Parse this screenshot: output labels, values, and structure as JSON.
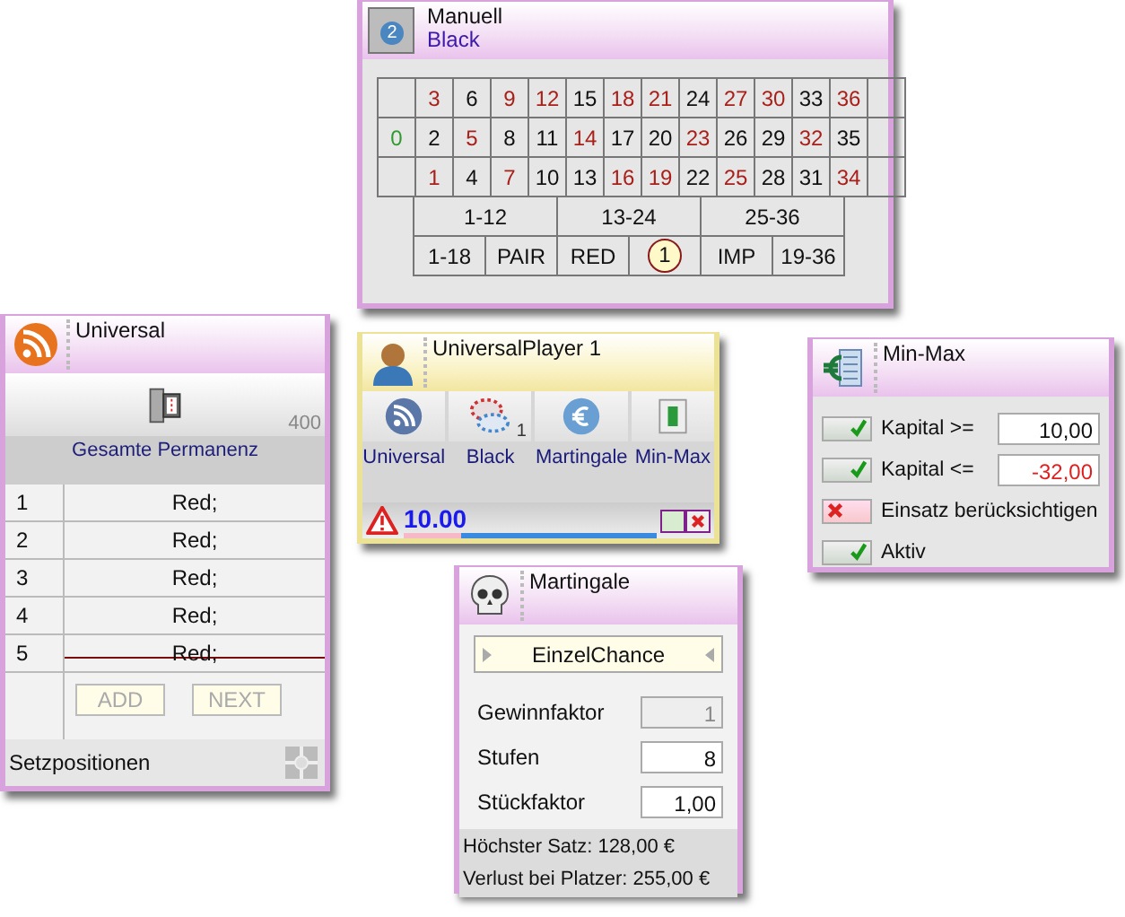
{
  "manuell": {
    "title": "Manuell",
    "subtitle": "Black",
    "badge": "2",
    "grid": [
      {
        "numbers": [
          {
            "label": "3",
            "color": "#a8201a"
          },
          {
            "label": "6",
            "color": "#111111"
          },
          {
            "label": "9",
            "color": "#a8201a"
          },
          {
            "label": "12",
            "color": "#a8201a"
          },
          {
            "label": "15",
            "color": "#111111"
          },
          {
            "label": "18",
            "color": "#a8201a"
          },
          {
            "label": "21",
            "color": "#a8201a"
          },
          {
            "label": "24",
            "color": "#111111"
          },
          {
            "label": "27",
            "color": "#a8201a"
          },
          {
            "label": "30",
            "color": "#a8201a"
          },
          {
            "label": "33",
            "color": "#111111"
          },
          {
            "label": "36",
            "color": "#a8201a"
          }
        ]
      },
      {
        "zero": {
          "label": "0",
          "color": "#2f9a2f"
        },
        "numbers": [
          {
            "label": "2",
            "color": "#111111"
          },
          {
            "label": "5",
            "color": "#a8201a"
          },
          {
            "label": "8",
            "color": "#111111"
          },
          {
            "label": "11",
            "color": "#111111"
          },
          {
            "label": "14",
            "color": "#a8201a"
          },
          {
            "label": "17",
            "color": "#111111"
          },
          {
            "label": "20",
            "color": "#111111"
          },
          {
            "label": "23",
            "color": "#a8201a"
          },
          {
            "label": "26",
            "color": "#111111"
          },
          {
            "label": "29",
            "color": "#111111"
          },
          {
            "label": "32",
            "color": "#a8201a"
          },
          {
            "label": "35",
            "color": "#111111"
          }
        ]
      },
      {
        "numbers": [
          {
            "label": "1",
            "color": "#a8201a"
          },
          {
            "label": "4",
            "color": "#111111"
          },
          {
            "label": "7",
            "color": "#a8201a"
          },
          {
            "label": "10",
            "color": "#111111"
          },
          {
            "label": "13",
            "color": "#111111"
          },
          {
            "label": "16",
            "color": "#a8201a"
          },
          {
            "label": "19",
            "color": "#a8201a"
          },
          {
            "label": "22",
            "color": "#111111"
          },
          {
            "label": "25",
            "color": "#a8201a"
          },
          {
            "label": "28",
            "color": "#111111"
          },
          {
            "label": "31",
            "color": "#111111"
          },
          {
            "label": "34",
            "color": "#a8201a"
          }
        ]
      }
    ],
    "dozens": [
      "1-12",
      "13-24",
      "25-36"
    ],
    "chances": [
      {
        "label": "1-18"
      },
      {
        "label": "PAIR"
      },
      {
        "label": "RED"
      },
      {
        "chip": "1"
      },
      {
        "label": "IMP"
      },
      {
        "label": "19-36"
      }
    ]
  },
  "universal": {
    "title": "Universal",
    "count": "400",
    "caption": "Gesamte Permanenz",
    "rows": [
      {
        "num": "1",
        "value": "Red;",
        "struck": false
      },
      {
        "num": "2",
        "value": "Red;",
        "struck": false
      },
      {
        "num": "3",
        "value": "Red;",
        "struck": false
      },
      {
        "num": "4",
        "value": "Red;",
        "struck": false
      },
      {
        "num": "5",
        "value": "Red;",
        "struck": true
      }
    ],
    "buttons": [
      {
        "label": "ADD",
        "disabled": true
      },
      {
        "label": "NEXT",
        "disabled": true
      }
    ],
    "footer": "Setzpositionen"
  },
  "player": {
    "title": "UniversalPlayer 1",
    "tools": [
      {
        "label": "Universal"
      },
      {
        "label": "Black",
        "count": "1"
      },
      {
        "label": "Martingale"
      },
      {
        "label": "Min-Max"
      }
    ],
    "amount": "10.00",
    "level": 0.23
  },
  "minmax": {
    "title": "Min-Max",
    "rows": [
      {
        "kind": "field",
        "label": "Kapital >=",
        "checked": true,
        "value": "10,00",
        "negative": false
      },
      {
        "kind": "field",
        "label": "Kapital <=",
        "checked": true,
        "value": "-32,00",
        "negative": true
      },
      {
        "kind": "toggle",
        "label": "Einsatz berücksichtigen",
        "checked": false
      },
      {
        "kind": "toggle",
        "label": "Aktiv",
        "checked": true
      }
    ]
  },
  "martingale": {
    "title": "Martingale",
    "select": "EinzelChance",
    "fields": [
      {
        "label": "Gewinnfaktor",
        "value": "1",
        "disabled": true
      },
      {
        "label": "Stufen",
        "value": "8",
        "disabled": false
      },
      {
        "label": "Stückfaktor",
        "value": "1,00",
        "disabled": false
      }
    ],
    "summary": [
      "Höchster Satz: 128,00 €",
      "Verlust bei Platzer: 255,00 €"
    ]
  }
}
